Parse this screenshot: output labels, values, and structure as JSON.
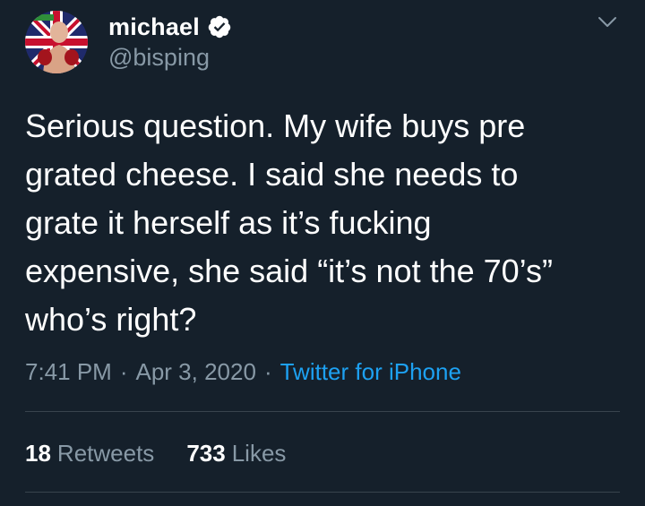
{
  "tweet": {
    "author": {
      "display_name": "michael",
      "handle": "@bisping",
      "verified": true,
      "avatar_icon": "boxer-with-union-jack-avatar",
      "verified_icon": "verified-badge-icon"
    },
    "menu_icon": "chevron-down-icon",
    "text": "Serious question. My wife buys pre\ngrated cheese. I said she needs to\ngrate it herself as it’s fucking\nexpensive, she said “it’s not the 70’s”\nwho’s right?",
    "time": "7:41 PM",
    "separator": "·",
    "date": "Apr 3, 2020",
    "source": "Twitter for iPhone",
    "stats": {
      "retweets_count": "18",
      "retweets_label": "Retweets",
      "likes_count": "733",
      "likes_label": "Likes"
    }
  },
  "colors": {
    "background": "#15202b",
    "text_primary": "#ffffff",
    "text_secondary": "#8899a6",
    "accent": "#1da1f2",
    "divider": "#38444d"
  }
}
